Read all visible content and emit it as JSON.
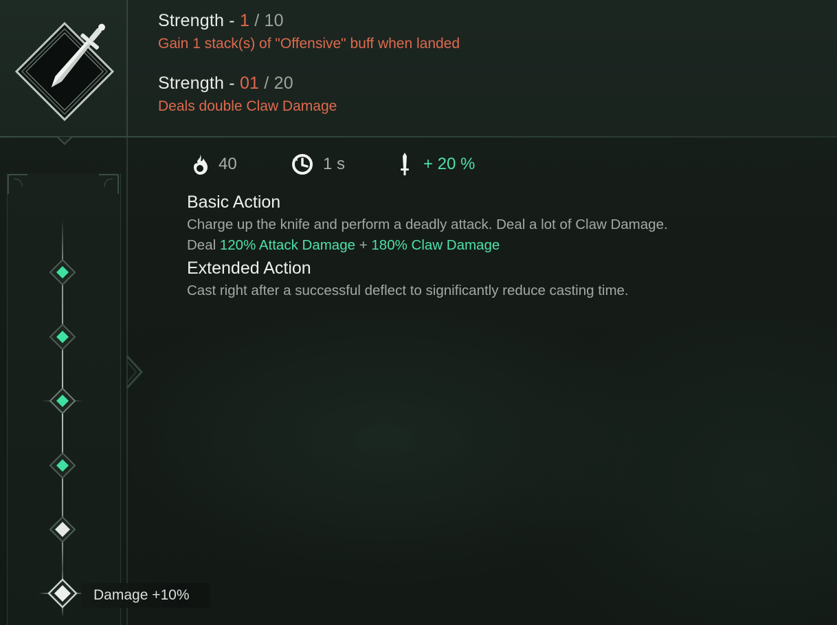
{
  "strength_rows": [
    {
      "label": "Strength - ",
      "current": "1",
      "sep": " / ",
      "max": "10",
      "effect": "Gain 1 stack(s) of \"Offensive\" buff when landed"
    },
    {
      "label": "Strength - ",
      "current": "01",
      "sep": " / ",
      "max": "20",
      "effect": "Deals double Claw Damage"
    }
  ],
  "stats": {
    "cost": {
      "icon": "flame-icon",
      "value": "40"
    },
    "cooldown": {
      "icon": "cooldown-clock-icon",
      "value": "1 s"
    },
    "bonus": {
      "icon": "dagger-icon",
      "value": "+ 20 %"
    }
  },
  "basic_action": {
    "title": "Basic Action",
    "line1": "Charge up the knife and perform a deadly attack. Deal a lot of Claw Damage.",
    "line2_prefix": "Deal ",
    "line2_hl1": "120% Attack Damage",
    "line2_mid": " + ",
    "line2_hl2": "180% Claw Damage"
  },
  "extended_action": {
    "title": "Extended Action",
    "line1": "Cast right after a successful deflect to significantly reduce casting time."
  },
  "upgrade_track": {
    "nodes": [
      {
        "state": "unlocked"
      },
      {
        "state": "unlocked"
      },
      {
        "state": "unlocked-selected"
      },
      {
        "state": "unlocked"
      },
      {
        "state": "locked"
      },
      {
        "state": "locked-hovered"
      }
    ],
    "hover_label": "Damage +10%"
  },
  "colors": {
    "accent_green": "#4fe0a8",
    "accent_orange": "#e2674c",
    "text_main": "#e9ece9",
    "text_dim": "#a3a8a3"
  }
}
